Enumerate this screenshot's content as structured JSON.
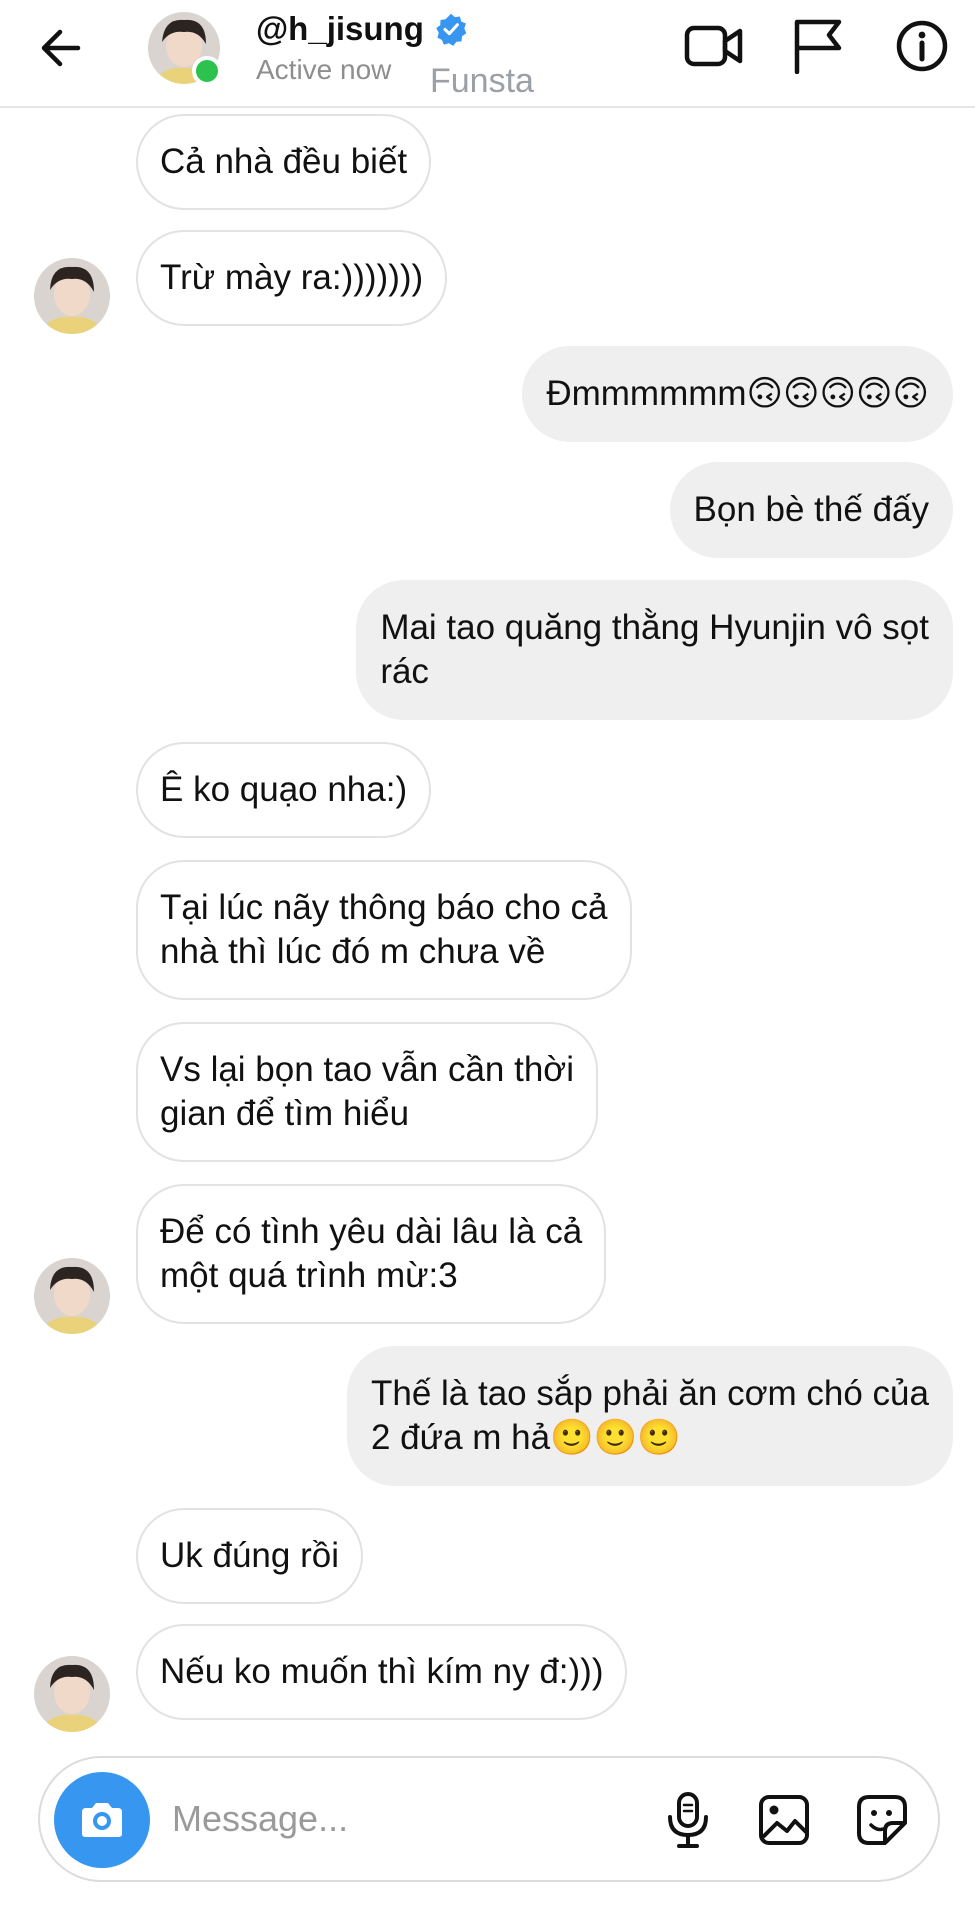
{
  "header": {
    "username": "@h_jisung",
    "status": "Active now",
    "overlay_text": "Funsta"
  },
  "messages": [
    {
      "side": "in",
      "text": "Cả nhà đều biết"
    },
    {
      "side": "in",
      "text": "Trừ mày ra:)))))))"
    },
    {
      "side": "out",
      "text": "Đmmmmmm🙃🙃🙃🙃🙃"
    },
    {
      "side": "out",
      "text": "Bọn bè thế đấy"
    },
    {
      "side": "out",
      "text": "Mai tao quăng thằng Hyunjin vô sọt\nrác"
    },
    {
      "side": "in",
      "text": "Ê ko quạo nha:)"
    },
    {
      "side": "in",
      "text": "Tại lúc nãy thông báo cho cả\nnhà thì lúc đó m chưa về"
    },
    {
      "side": "in",
      "text": "Vs lại bọn tao vẫn cần thời\ngian để tìm hiểu"
    },
    {
      "side": "in",
      "text": "Để có tình yêu dài lâu là cả\nmột quá trình mừ:3"
    },
    {
      "side": "out",
      "text": "Thế là tao sắp phải ăn cơm chó của\n2 đứa m hả🙂🙂🙂"
    },
    {
      "side": "in",
      "text": "Uk đúng rồi"
    },
    {
      "side": "in",
      "text": "Nếu ko muốn thì kím ny đ:)))"
    }
  ],
  "composer": {
    "placeholder": "Message..."
  },
  "colors": {
    "accent": "#3797f0",
    "verified": "#3797f0",
    "online": "#2bc24e",
    "outgoing_bubble": "#efefef",
    "incoming_border": "#e2e2e2"
  },
  "icons": [
    "back-arrow-icon",
    "verified-badge-icon",
    "video-call-icon",
    "flag-icon",
    "info-icon",
    "camera-icon",
    "microphone-icon",
    "image-icon",
    "sticker-icon"
  ]
}
